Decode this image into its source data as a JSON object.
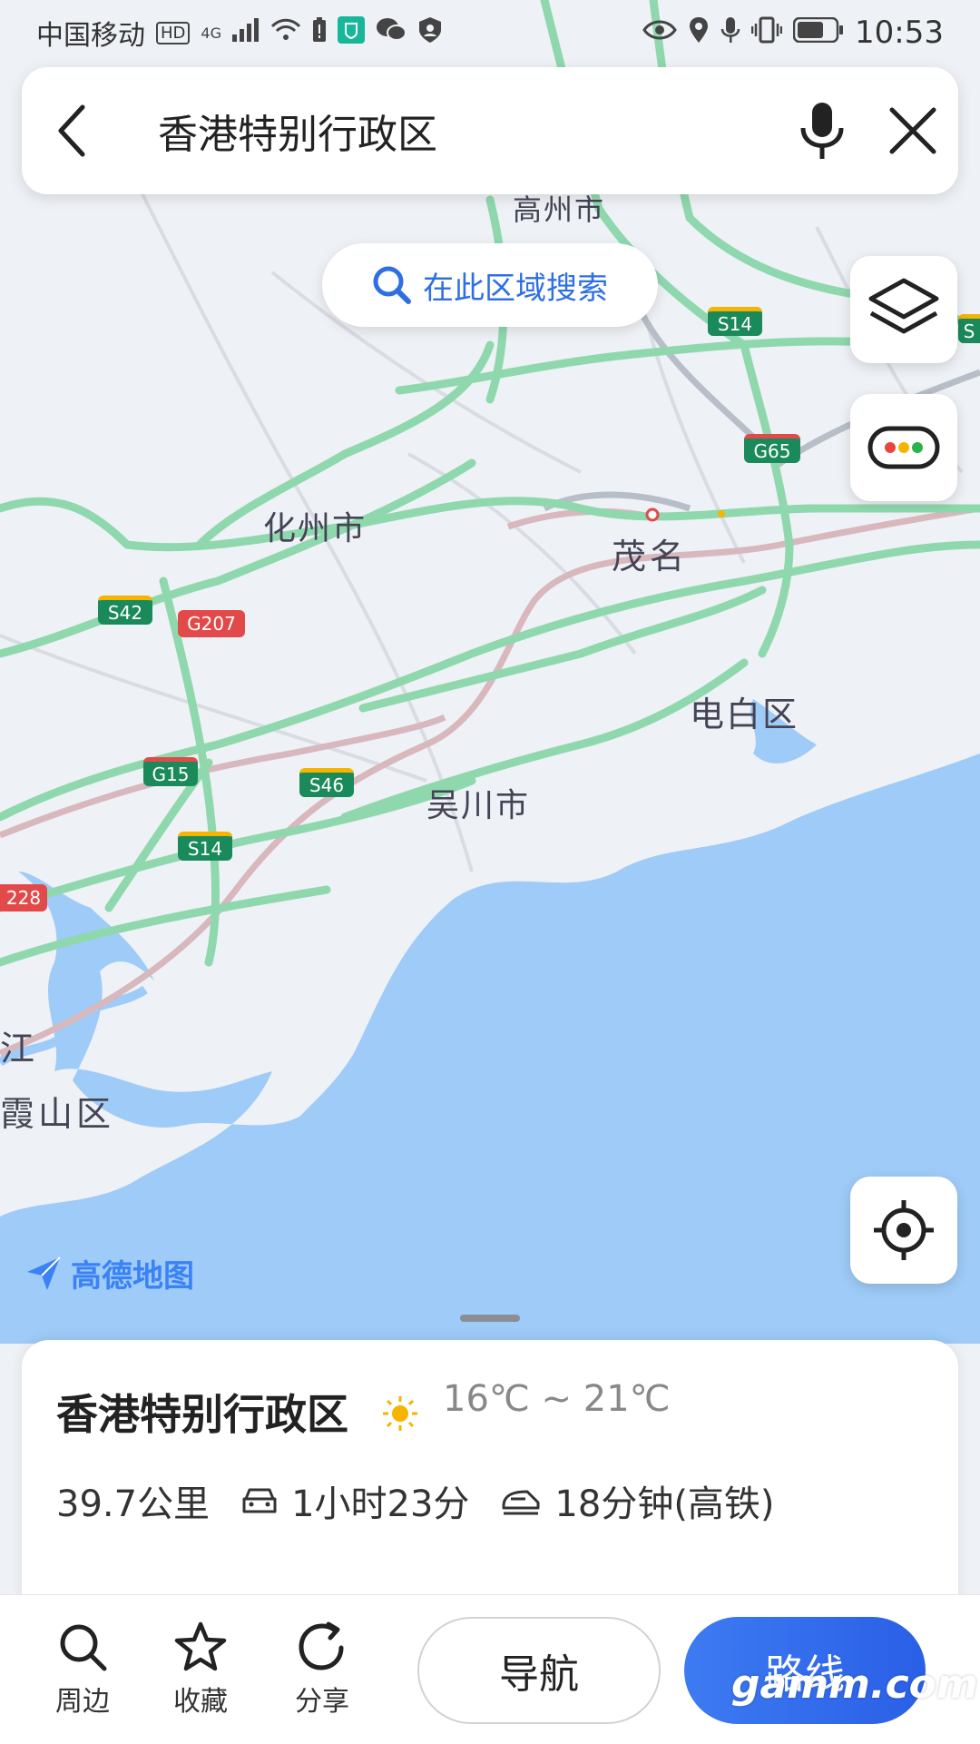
{
  "status_bar": {
    "carrier": "中国移动",
    "hd_badge": "HD",
    "network": "4G",
    "time": "10:53"
  },
  "search": {
    "query": "香港特别行政区"
  },
  "map": {
    "area_search_label": "在此区域搜索",
    "labels": [
      "高州市",
      "化州市",
      "茂名",
      "电白区",
      "吴川市",
      "江",
      "霞山区"
    ],
    "road_badges": [
      {
        "text": "S14",
        "color": "#1b8a5a"
      },
      {
        "text": "G65",
        "color": "#1b8a5a"
      },
      {
        "text": "S42",
        "color": "#1b8a5a"
      },
      {
        "text": "G207",
        "color": "#e24a4a"
      },
      {
        "text": "G15",
        "color": "#1b8a5a"
      },
      {
        "text": "S46",
        "color": "#1b8a5a"
      },
      {
        "text": "S14",
        "color": "#1b8a5a"
      },
      {
        "text": "228",
        "color": "#e24a4a"
      },
      {
        "text": "S",
        "color": "#1b8a5a"
      }
    ],
    "brand": "高德地图"
  },
  "sheet": {
    "place_name": "香港特别行政区",
    "weather_icon": "sun-icon",
    "temperature": "16℃ ~ 21℃",
    "distance": "39.7公里",
    "drive_time": "1小时23分",
    "rail_time": "18分钟(高铁)"
  },
  "toolbar": {
    "nearby": "周边",
    "favorite": "收藏",
    "share": "分享",
    "navigate": "导航",
    "route": "路线"
  },
  "watermark": "gamm.com",
  "colors": {
    "sea": "#9ecbf7",
    "land": "#eef1f5",
    "highway": "#8fd8ae",
    "accent": "#2f6fe4"
  }
}
